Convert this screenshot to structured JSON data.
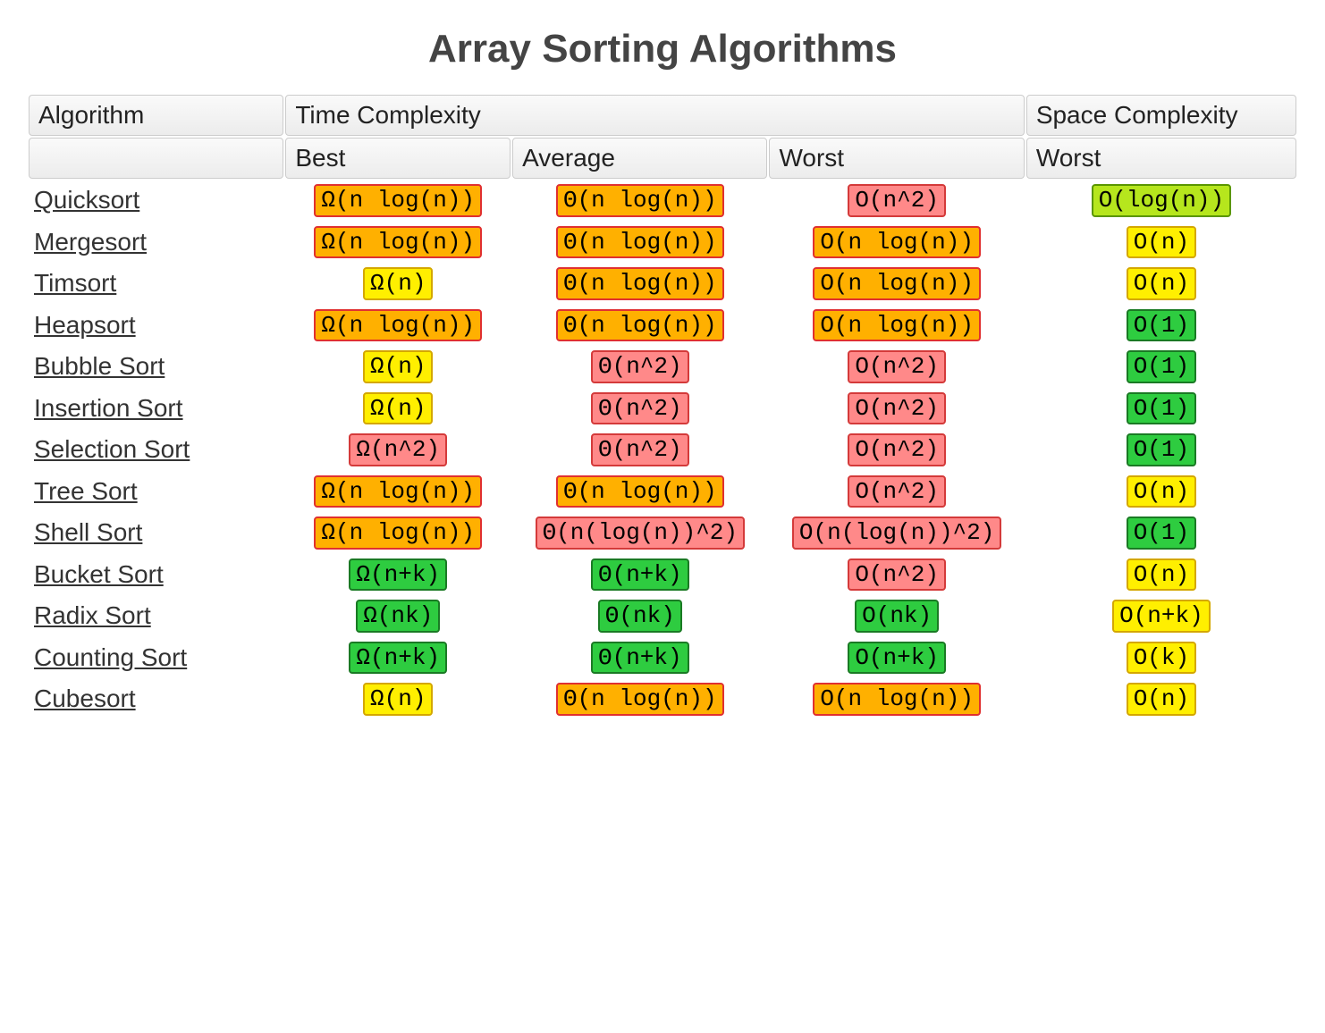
{
  "title": "Array Sorting Algorithms",
  "headers": {
    "algorithm": "Algorithm",
    "time_complexity": "Time Complexity",
    "space_complexity": "Space Complexity",
    "best": "Best",
    "average": "Average",
    "worst_time": "Worst",
    "worst_space": "Worst"
  },
  "rows": [
    {
      "name": "Quicksort",
      "best": {
        "v": "Ω(n log(n))",
        "c": "orange"
      },
      "avg": {
        "v": "Θ(n log(n))",
        "c": "orange"
      },
      "worst": {
        "v": "O(n^2)",
        "c": "red"
      },
      "space": {
        "v": "O(log(n))",
        "c": "lime"
      }
    },
    {
      "name": "Mergesort",
      "best": {
        "v": "Ω(n log(n))",
        "c": "orange"
      },
      "avg": {
        "v": "Θ(n log(n))",
        "c": "orange"
      },
      "worst": {
        "v": "O(n log(n))",
        "c": "orange"
      },
      "space": {
        "v": "O(n)",
        "c": "yellow"
      }
    },
    {
      "name": "Timsort",
      "best": {
        "v": "Ω(n)",
        "c": "yellow"
      },
      "avg": {
        "v": "Θ(n log(n))",
        "c": "orange"
      },
      "worst": {
        "v": "O(n log(n))",
        "c": "orange"
      },
      "space": {
        "v": "O(n)",
        "c": "yellow"
      }
    },
    {
      "name": "Heapsort",
      "best": {
        "v": "Ω(n log(n))",
        "c": "orange"
      },
      "avg": {
        "v": "Θ(n log(n))",
        "c": "orange"
      },
      "worst": {
        "v": "O(n log(n))",
        "c": "orange"
      },
      "space": {
        "v": "O(1)",
        "c": "green"
      }
    },
    {
      "name": "Bubble Sort",
      "best": {
        "v": "Ω(n)",
        "c": "yellow"
      },
      "avg": {
        "v": "Θ(n^2)",
        "c": "red"
      },
      "worst": {
        "v": "O(n^2)",
        "c": "red"
      },
      "space": {
        "v": "O(1)",
        "c": "green"
      }
    },
    {
      "name": "Insertion Sort",
      "best": {
        "v": "Ω(n)",
        "c": "yellow"
      },
      "avg": {
        "v": "Θ(n^2)",
        "c": "red"
      },
      "worst": {
        "v": "O(n^2)",
        "c": "red"
      },
      "space": {
        "v": "O(1)",
        "c": "green"
      }
    },
    {
      "name": "Selection Sort",
      "best": {
        "v": "Ω(n^2)",
        "c": "red"
      },
      "avg": {
        "v": "Θ(n^2)",
        "c": "red"
      },
      "worst": {
        "v": "O(n^2)",
        "c": "red"
      },
      "space": {
        "v": "O(1)",
        "c": "green"
      }
    },
    {
      "name": "Tree Sort",
      "best": {
        "v": "Ω(n log(n))",
        "c": "orange"
      },
      "avg": {
        "v": "Θ(n log(n))",
        "c": "orange"
      },
      "worst": {
        "v": "O(n^2)",
        "c": "red"
      },
      "space": {
        "v": "O(n)",
        "c": "yellow"
      }
    },
    {
      "name": "Shell Sort",
      "best": {
        "v": "Ω(n log(n))",
        "c": "orange"
      },
      "avg": {
        "v": "Θ(n(log(n))^2)",
        "c": "red"
      },
      "worst": {
        "v": "O(n(log(n))^2)",
        "c": "red"
      },
      "space": {
        "v": "O(1)",
        "c": "green"
      }
    },
    {
      "name": "Bucket Sort",
      "best": {
        "v": "Ω(n+k)",
        "c": "green"
      },
      "avg": {
        "v": "Θ(n+k)",
        "c": "green"
      },
      "worst": {
        "v": "O(n^2)",
        "c": "red"
      },
      "space": {
        "v": "O(n)",
        "c": "yellow"
      }
    },
    {
      "name": "Radix Sort",
      "best": {
        "v": "Ω(nk)",
        "c": "green"
      },
      "avg": {
        "v": "Θ(nk)",
        "c": "green"
      },
      "worst": {
        "v": "O(nk)",
        "c": "green"
      },
      "space": {
        "v": "O(n+k)",
        "c": "yellow"
      }
    },
    {
      "name": "Counting Sort",
      "best": {
        "v": "Ω(n+k)",
        "c": "green"
      },
      "avg": {
        "v": "Θ(n+k)",
        "c": "green"
      },
      "worst": {
        "v": "O(n+k)",
        "c": "green"
      },
      "space": {
        "v": "O(k)",
        "c": "yellow"
      }
    },
    {
      "name": "Cubesort",
      "best": {
        "v": "Ω(n)",
        "c": "yellow"
      },
      "avg": {
        "v": "Θ(n log(n))",
        "c": "orange"
      },
      "worst": {
        "v": "O(n log(n))",
        "c": "orange"
      },
      "space": {
        "v": "O(n)",
        "c": "yellow"
      }
    }
  ]
}
